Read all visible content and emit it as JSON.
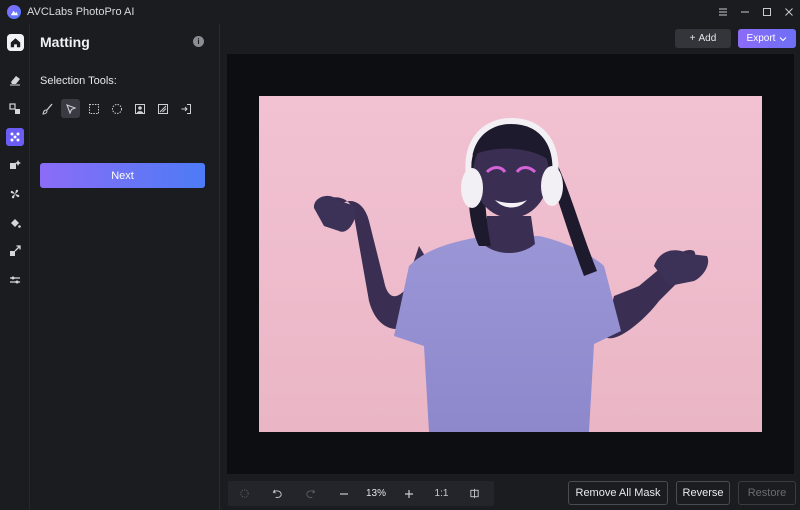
{
  "app": {
    "title": "AVCLabs PhotoPro AI"
  },
  "window_controls": [
    "menu-icon",
    "minimize-icon",
    "maximize-icon",
    "close-icon"
  ],
  "sidebar_icons": [
    {
      "name": "home-icon",
      "active": false
    },
    {
      "name": "eraser-icon",
      "active": false
    },
    {
      "name": "replace-icon",
      "active": false
    },
    {
      "name": "matting-icon",
      "active": true
    },
    {
      "name": "enhance-icon",
      "active": false
    },
    {
      "name": "fan-icon",
      "active": false
    },
    {
      "name": "colorize-icon",
      "active": false
    },
    {
      "name": "resize-icon",
      "active": false
    },
    {
      "name": "adjust-icon",
      "active": false
    }
  ],
  "panel": {
    "title": "Matting",
    "selection_tools_label": "Selection Tools:",
    "tools": [
      "brush-icon",
      "pointer-icon",
      "rect-select-icon",
      "ellipse-select-icon",
      "portrait-icon",
      "object-icon",
      "import-icon"
    ],
    "active_tool": "pointer-icon",
    "next_label": "Next"
  },
  "toolbar": {
    "add_label": "Add",
    "export_label": "Export"
  },
  "zoom": {
    "percent": "13%",
    "ratio": "1:1"
  },
  "bottom": {
    "remove_all_mask": "Remove All Mask",
    "reverse": "Reverse",
    "restore": "Restore"
  },
  "colors": {
    "accent": "#6a5cf5",
    "gradient_start": "#8b6cf7",
    "gradient_end": "#4d7bf6",
    "background": "#1b1c20",
    "canvas": "#0c0e11"
  }
}
